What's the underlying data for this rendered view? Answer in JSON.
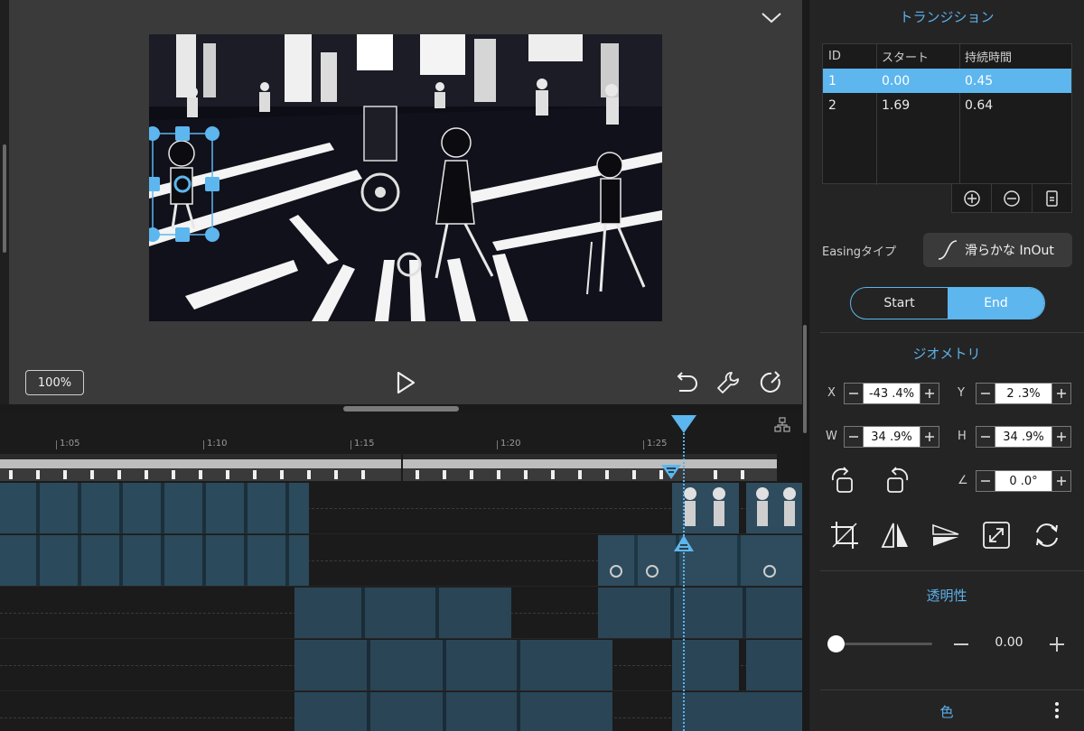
{
  "preview": {
    "zoom_label": "100%",
    "icons": {
      "collapse": "chevron-down-icon",
      "play": "play-icon",
      "undo": "undo-icon",
      "tools": "wrench-icon",
      "redo": "redo-icon"
    }
  },
  "timeline": {
    "ticks": [
      "1:05",
      "1:10",
      "1:15",
      "1:20",
      "1:25"
    ]
  },
  "panel": {
    "transition": {
      "title": "トランジション",
      "columns": [
        "ID",
        "スタート",
        "持続時間"
      ],
      "rows": [
        {
          "id": "1",
          "start": "0.00",
          "duration": "0.45"
        },
        {
          "id": "2",
          "start": "1.69",
          "duration": "0.64"
        }
      ],
      "selected_row": 0
    },
    "easing": {
      "label": "Easingタイプ",
      "value": "滑らかな InOut"
    },
    "segment": {
      "start_label": "Start",
      "end_label": "End",
      "active": "End"
    },
    "geometry": {
      "title": "ジオメトリ",
      "x_label": "X",
      "x_value": "-43 .4%",
      "y_label": "Y",
      "y_value": "2  .3%",
      "w_label": "W",
      "w_value": "34 .9%",
      "h_label": "H",
      "h_value": "34 .9%",
      "angle_label": "∠",
      "angle_value": "0  .0°"
    },
    "opacity": {
      "title": "透明性",
      "value": "0.00",
      "level": 0
    },
    "color": {
      "title": "色"
    }
  },
  "colors": {
    "accent": "#5db6ee",
    "panel_bg": "#242424",
    "preview_bg": "#3a3a3a"
  }
}
